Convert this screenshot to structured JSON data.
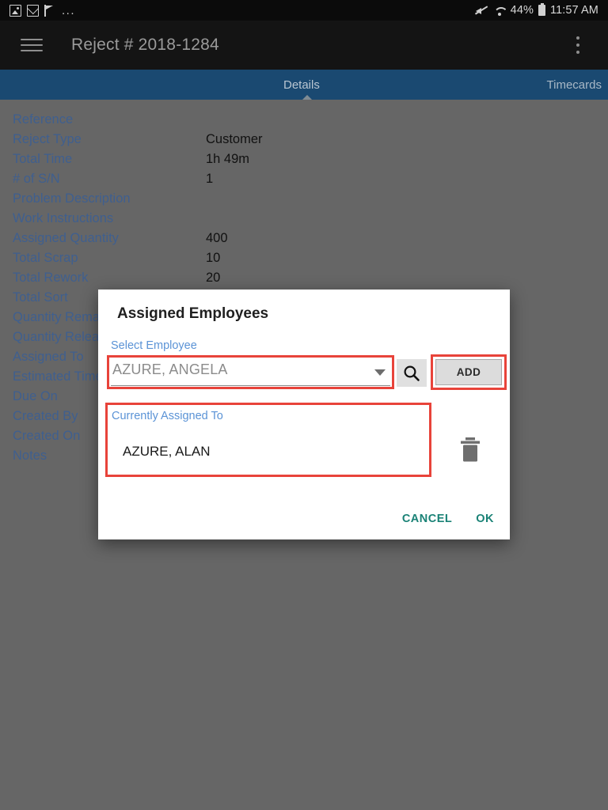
{
  "status_bar": {
    "notification_icons": [
      "photo-icon",
      "mail-icon",
      "flag-icon"
    ],
    "overflow_dots": "...",
    "mute_icon": "mute-icon",
    "wifi_icon": "wifi-icon",
    "battery_percent": "44%",
    "battery_icon": "battery-icon",
    "time": "11:57 AM"
  },
  "app_bar": {
    "menu_icon": "hamburger-menu-icon",
    "title": "Reject # 2018-1284",
    "overflow_icon": "more-vertical-icon"
  },
  "tabs": [
    {
      "label": "Details",
      "selected": true
    },
    {
      "label": "Timecards",
      "selected": false
    }
  ],
  "details": {
    "rows": [
      {
        "label": "Reference",
        "value": ""
      },
      {
        "label": "Reject Type",
        "value": "Customer"
      },
      {
        "label": "Total Time",
        "value": "1h 49m"
      },
      {
        "label": "# of S/N",
        "value": "1"
      },
      {
        "label": "Problem Description",
        "value": ""
      },
      {
        "label": "Work Instructions",
        "value": ""
      },
      {
        "label": "Assigned Quantity",
        "value": "400"
      },
      {
        "label": "Total Scrap",
        "value": "10"
      },
      {
        "label": "Total Rework",
        "value": "20"
      },
      {
        "label": "Total Sort",
        "value": ""
      },
      {
        "label": "Quantity Remaining",
        "value": ""
      },
      {
        "label": "Quantity Released",
        "value": ""
      },
      {
        "label": "Assigned To",
        "value": ""
      },
      {
        "label": "Estimated Time",
        "value": ""
      },
      {
        "label": "Due On",
        "value": ""
      },
      {
        "label": "Created By",
        "value": ""
      },
      {
        "label": "Created On",
        "value": ""
      },
      {
        "label": "Notes",
        "value": ""
      }
    ]
  },
  "dialog": {
    "title": "Assigned Employees",
    "select_employee_label": "Select Employee",
    "employee_dropdown_value": "AZURE, ANGELA",
    "dropdown_caret_icon": "chevron-down-icon",
    "search_icon": "search-icon",
    "add_button_label": "ADD",
    "currently_assigned_label": "Currently Assigned To",
    "assigned_employees": [
      "AZURE, ALAN"
    ],
    "delete_icon": "trash-icon",
    "cancel_label": "CANCEL",
    "ok_label": "OK"
  },
  "colors": {
    "accent_teal": "#1a8276",
    "label_blue": "#3f5f8f",
    "dialog_label_blue": "#5b93d6",
    "highlight_red": "#e8433a",
    "tabbar_blue": "#1a4971",
    "scrim_gray": "#666666"
  }
}
